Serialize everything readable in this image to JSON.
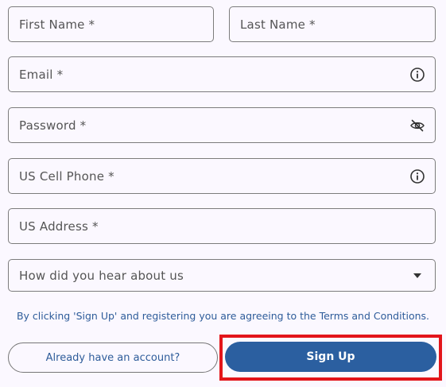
{
  "form": {
    "first_name_label": "First Name *",
    "last_name_label": "Last Name *",
    "email_label": "Email *",
    "password_label": "Password *",
    "phone_label": "US Cell Phone *",
    "address_label": "US Address *",
    "referral_select_value": "How did you hear about us",
    "icons": {
      "email_info": "info-icon",
      "password_toggle": "eye-slash-icon",
      "phone_info": "info-icon",
      "select_arrow": "caret-down-icon"
    }
  },
  "terms_text": "By clicking 'Sign Up' and registering you are agreeing to the Terms and Conditions.",
  "actions": {
    "login_link_label": "Already have an account?",
    "signup_label": "Sign Up"
  },
  "colors": {
    "background": "#fbf8ff",
    "primary": "#2b5fa0",
    "link": "#2e5c9a",
    "highlight": "#e3151b",
    "border": "#7c7c7c"
  }
}
